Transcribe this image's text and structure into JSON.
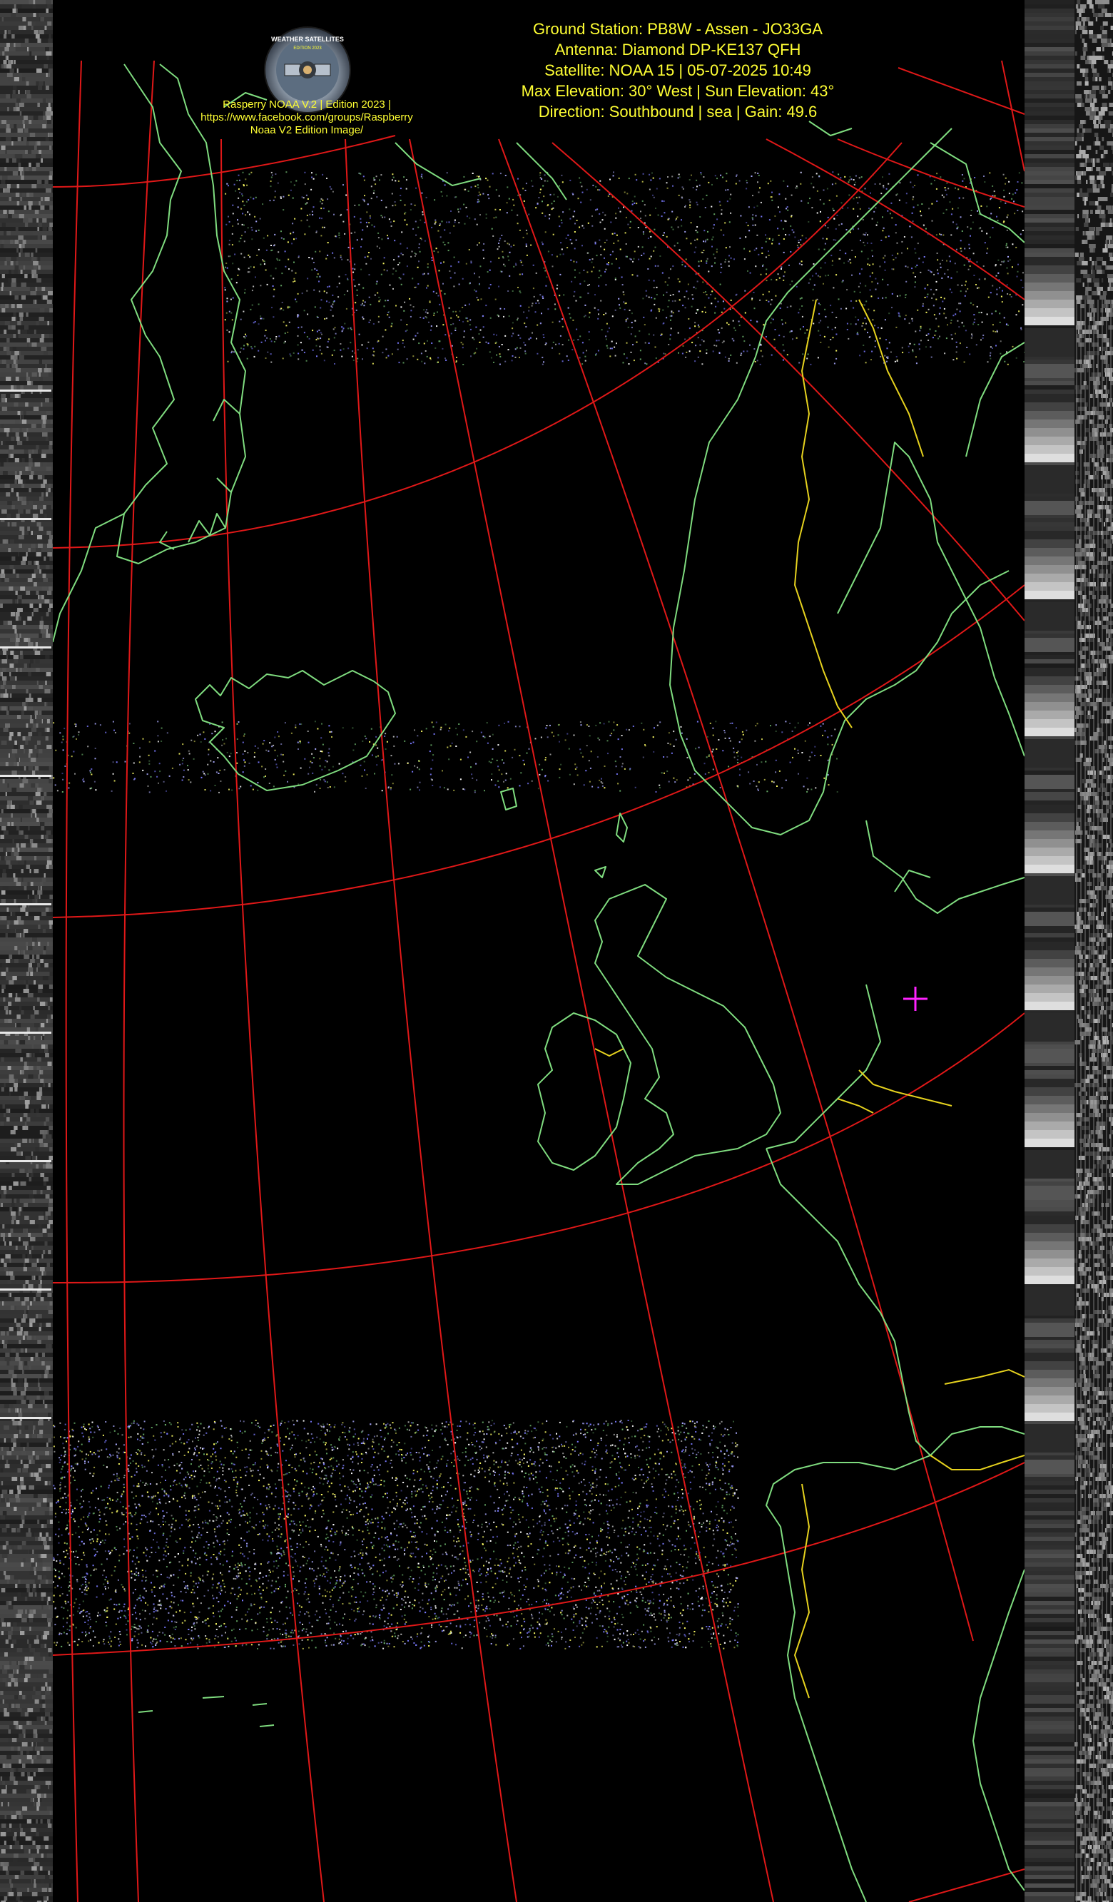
{
  "header": {
    "lines": [
      "Ground Station: PB8W - Assen - JO33GA",
      "Antenna: Diamond DP-KE137 QFH",
      "Satellite: NOAA 15 | 05-07-2025 10:49",
      "Max Elevation: 30° West | Sun Elevation: 43°",
      "Direction: Southbound | sea | Gain: 49.6"
    ],
    "credit_lines": [
      "Rasperry NOAA V.2 | Edition 2023 |",
      "https://www.facebook.com/groups/Raspberry",
      "Noaa V2 Edition Image/"
    ]
  },
  "logo": {
    "text_top": "WEATHER SATELLITES",
    "text_mid": "EDITION 2023",
    "icon": "satellite-icon"
  },
  "colors": {
    "background": "#000000",
    "graticule": "#e01818",
    "coastline": "#7fdc7f",
    "borders": "#e6d21e",
    "text": "#ffff33",
    "station_marker": "#ff22ff"
  },
  "station_marker": {
    "icon": "crosshair-icon",
    "label": "PB8W - Assen"
  }
}
